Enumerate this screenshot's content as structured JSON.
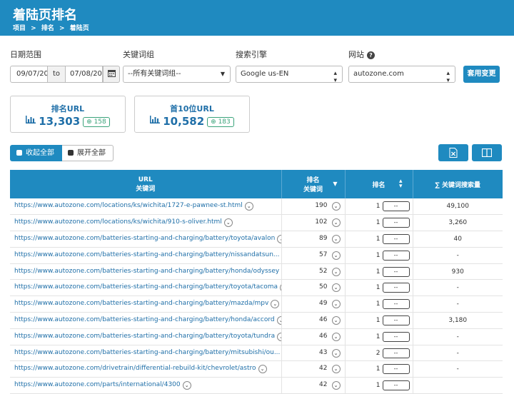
{
  "header": {
    "title": "着陆页排名",
    "breadcrumb": [
      "项目",
      ">",
      "排名",
      ">",
      "着陆页"
    ]
  },
  "filters": {
    "date_label": "日期范围",
    "date_from": "09/07/20",
    "to_label": "to",
    "date_to": "07/08/20",
    "keyword_group_label": "关键词组",
    "keyword_group_value": "--所有关键词组--",
    "engine_label": "搜索引擎",
    "engine_value": "Google us-EN",
    "site_label": "网站",
    "site_value": "autozone.com",
    "apply_label": "套用变更"
  },
  "stats": [
    {
      "title": "排名URL",
      "value": "13,303",
      "delta": "158"
    },
    {
      "title": "首10位URL",
      "value": "10,582",
      "delta": "183"
    }
  ],
  "actions": {
    "collapse_all": "收起全部",
    "expand_all": "展开全部"
  },
  "table": {
    "headers": {
      "url": "URL",
      "url_sub": "关键词",
      "rank_kw": "排名",
      "rank_kw_sub": "关键词",
      "rank": "排名",
      "volume": "∑ 关键词搜索量"
    },
    "rows": [
      {
        "url": "https://www.autozone.com/locations/ks/wichita/1727-e-pawnee-st.html",
        "kw": "190",
        "pos": "1",
        "pos_box": "--",
        "vol": "49,100"
      },
      {
        "url": "https://www.autozone.com/locations/ks/wichita/910-s-oliver.html",
        "kw": "102",
        "pos": "1",
        "pos_box": "--",
        "vol": "3,260"
      },
      {
        "url": "https://www.autozone.com/batteries-starting-and-charging/battery/toyota/avalon",
        "kw": "89",
        "pos": "1",
        "pos_box": "--",
        "vol": "40"
      },
      {
        "url": "https://www.autozone.com/batteries-starting-and-charging/battery/nissandatsun...",
        "kw": "57",
        "pos": "1",
        "pos_box": "--",
        "vol": "-"
      },
      {
        "url": "https://www.autozone.com/batteries-starting-and-charging/battery/honda/odyssey",
        "kw": "52",
        "pos": "1",
        "pos_box": "--",
        "vol": "930"
      },
      {
        "url": "https://www.autozone.com/batteries-starting-and-charging/battery/toyota/tacoma",
        "kw": "50",
        "pos": "1",
        "pos_box": "--",
        "vol": "-"
      },
      {
        "url": "https://www.autozone.com/batteries-starting-and-charging/battery/mazda/mpv",
        "kw": "49",
        "pos": "1",
        "pos_box": "--",
        "vol": "-"
      },
      {
        "url": "https://www.autozone.com/batteries-starting-and-charging/battery/honda/accord",
        "kw": "46",
        "pos": "1",
        "pos_box": "--",
        "vol": "3,180"
      },
      {
        "url": "https://www.autozone.com/batteries-starting-and-charging/battery/toyota/tundra",
        "kw": "46",
        "pos": "1",
        "pos_box": "--",
        "vol": "-"
      },
      {
        "url": "https://www.autozone.com/batteries-starting-and-charging/battery/mitsubishi/ou...",
        "kw": "43",
        "pos": "2",
        "pos_box": "--",
        "vol": "-"
      },
      {
        "url": "https://www.autozone.com/drivetrain/differential-rebuild-kit/chevrolet/astro",
        "kw": "42",
        "pos": "1",
        "pos_box": "--",
        "vol": "-"
      },
      {
        "url": "https://www.autozone.com/parts/international/4300",
        "kw": "42",
        "pos": "1",
        "pos_box": "--",
        "vol": ""
      }
    ]
  }
}
